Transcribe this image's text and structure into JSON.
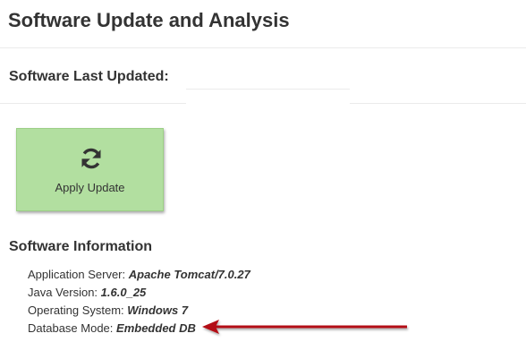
{
  "page": {
    "title": "Software Update and Analysis"
  },
  "last_updated": {
    "label": "Software Last Updated:",
    "value": ""
  },
  "update_button": {
    "label": "Apply Update",
    "icon": "refresh-icon"
  },
  "software_info": {
    "heading": "Software Information",
    "rows": [
      {
        "label": "Application Server:",
        "value": "Apache Tomcat/7.0.27"
      },
      {
        "label": "Java Version:",
        "value": "1.6.0_25"
      },
      {
        "label": "Operating System:",
        "value": "Windows 7"
      },
      {
        "label": "Database Mode:",
        "value": "Embedded DB"
      }
    ]
  },
  "colors": {
    "button_bg": "#b2dfa0",
    "arrow": "#b30d12",
    "text": "#333333"
  }
}
